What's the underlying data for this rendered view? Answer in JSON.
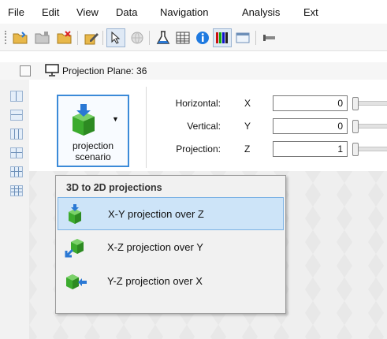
{
  "menubar": {
    "items": [
      "File",
      "Edit",
      "View",
      "Data",
      "Navigation",
      "Analysis",
      "Ext"
    ]
  },
  "toolbar": {
    "icons": [
      "open-folder-icon",
      "close-folder-icon",
      "delete-folder-icon",
      "edit-icon",
      "pointer-icon",
      "globe-icon",
      "flask-icon",
      "grid-table-icon",
      "info-icon",
      "bar-chart-icon",
      "window-icon",
      "pipe-icon"
    ]
  },
  "view": {
    "title": "Projection Plane: 36"
  },
  "scenario_button": {
    "line1": "projection",
    "line2": "scenario"
  },
  "fields": [
    {
      "label": "Horizontal:",
      "axis": "X",
      "value": "0"
    },
    {
      "label": "Vertical:",
      "axis": "Y",
      "value": "0"
    },
    {
      "label": "Projection:",
      "axis": "Z",
      "value": "1"
    }
  ],
  "dropdown": {
    "header": "3D to 2D projections",
    "items": [
      {
        "label": "X-Y projection over Z",
        "selected": true
      },
      {
        "label": "X-Z projection over Y",
        "selected": false
      },
      {
        "label": "Y-Z projection over X",
        "selected": false
      }
    ]
  },
  "colors": {
    "accent": "#3b8ad8",
    "selection": "#cde4f8",
    "cube_green": "#3cab2e",
    "arrow_blue": "#2a78d4"
  }
}
